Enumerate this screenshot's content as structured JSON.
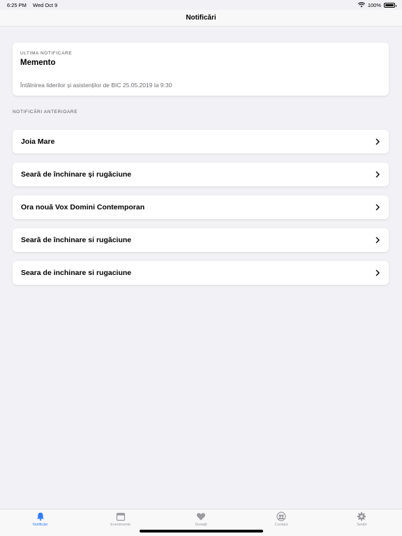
{
  "status": {
    "time": "6:25 PM",
    "date": "Wed Oct 9",
    "battery": "100%"
  },
  "nav": {
    "title": "Notificări"
  },
  "last_notification": {
    "eyebrow": "ULTIMA NOTIFICARE",
    "title": "Memento",
    "body": "Întâlnirea liderilor și asistenților de BIC 25.05.2019 la 9:30"
  },
  "previous": {
    "section_label": "NOTIFICĂRI ANTERIOARE",
    "items": [
      {
        "label": "Joia Mare"
      },
      {
        "label": "Seară de închinare și rugăciune"
      },
      {
        "label": "Ora nouă Vox Domini Contemporan"
      },
      {
        "label": "Seară de închinare si rugăciune"
      },
      {
        "label": "Seara de inchinare si rugaciune"
      }
    ]
  },
  "tabs": [
    {
      "label": "Notificări",
      "icon": "bell-icon",
      "active": true
    },
    {
      "label": "Evenimente",
      "icon": "calendar-icon",
      "active": false
    },
    {
      "label": "Donații",
      "icon": "heart-icon",
      "active": false
    },
    {
      "label": "Contact",
      "icon": "contacts-icon",
      "active": false
    },
    {
      "label": "Setări",
      "icon": "gear-icon",
      "active": false
    }
  ],
  "colors": {
    "accent": "#2f7cf6",
    "background": "#f2f2f6",
    "inactive": "#9a9a9f"
  }
}
